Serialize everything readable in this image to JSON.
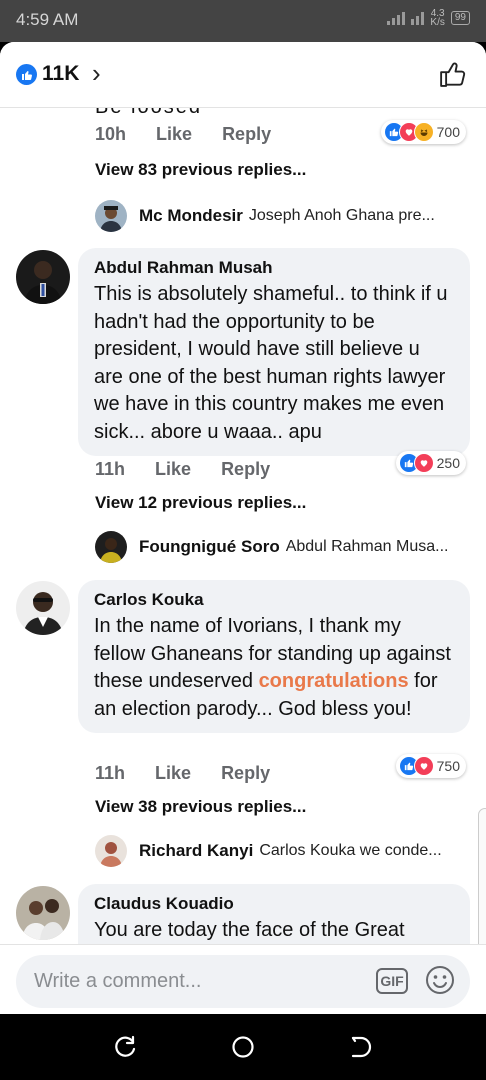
{
  "status": {
    "time": "4:59 AM",
    "speed_value": "4.3",
    "speed_unit": "K/s",
    "battery": "99"
  },
  "header": {
    "reaction_count": "11K"
  },
  "top_snippet": "Be loosed",
  "comments": [
    {
      "actions": {
        "time": "10h",
        "like": "Like",
        "reply": "Reply"
      },
      "reaction_total": "700",
      "view_prev": "View 83 previous replies...",
      "reply_preview": {
        "name": "Mc Mondesir",
        "text": "Joseph Anoh  Ghana pre..."
      }
    },
    {
      "author": "Abdul Rahman Musah",
      "text": "This is absolutely shameful.. to think if u hadn't had the opportunity to be president, I would have still believe u are one of the best human rights lawyer we have in this country makes me even sick... abore u waaa.. apu",
      "actions": {
        "time": "11h",
        "like": "Like",
        "reply": "Reply"
      },
      "reaction_total": "250",
      "view_prev": "View 12 previous replies...",
      "reply_preview": {
        "name": "Foungnigué Soro",
        "text": "Abdul Rahman Musa..."
      }
    },
    {
      "author": "Carlos Kouka",
      "text_before": "In the name of Ivorians, I thank my fellow Ghaneans for standing up against these undeserved ",
      "text_link": "congratulations",
      "text_after": " for an election parody... God bless you!",
      "actions": {
        "time": "11h",
        "like": "Like",
        "reply": "Reply"
      },
      "reaction_total": "750",
      "view_prev": "View 38 previous replies...",
      "reply_preview": {
        "name": "Richard Kanyi",
        "text": "Carlos Kouka we conde..."
      }
    },
    {
      "author": "Claudus Kouadio",
      "text": "You are today the face of the Great"
    }
  ],
  "composer": {
    "placeholder": "Write a comment...",
    "gif_label": "GIF"
  },
  "colors": {
    "like_blue": "#1877f2",
    "love_red": "#f33e58",
    "haha_yellow": "#f7b125",
    "link_orange": "#e9794a"
  }
}
